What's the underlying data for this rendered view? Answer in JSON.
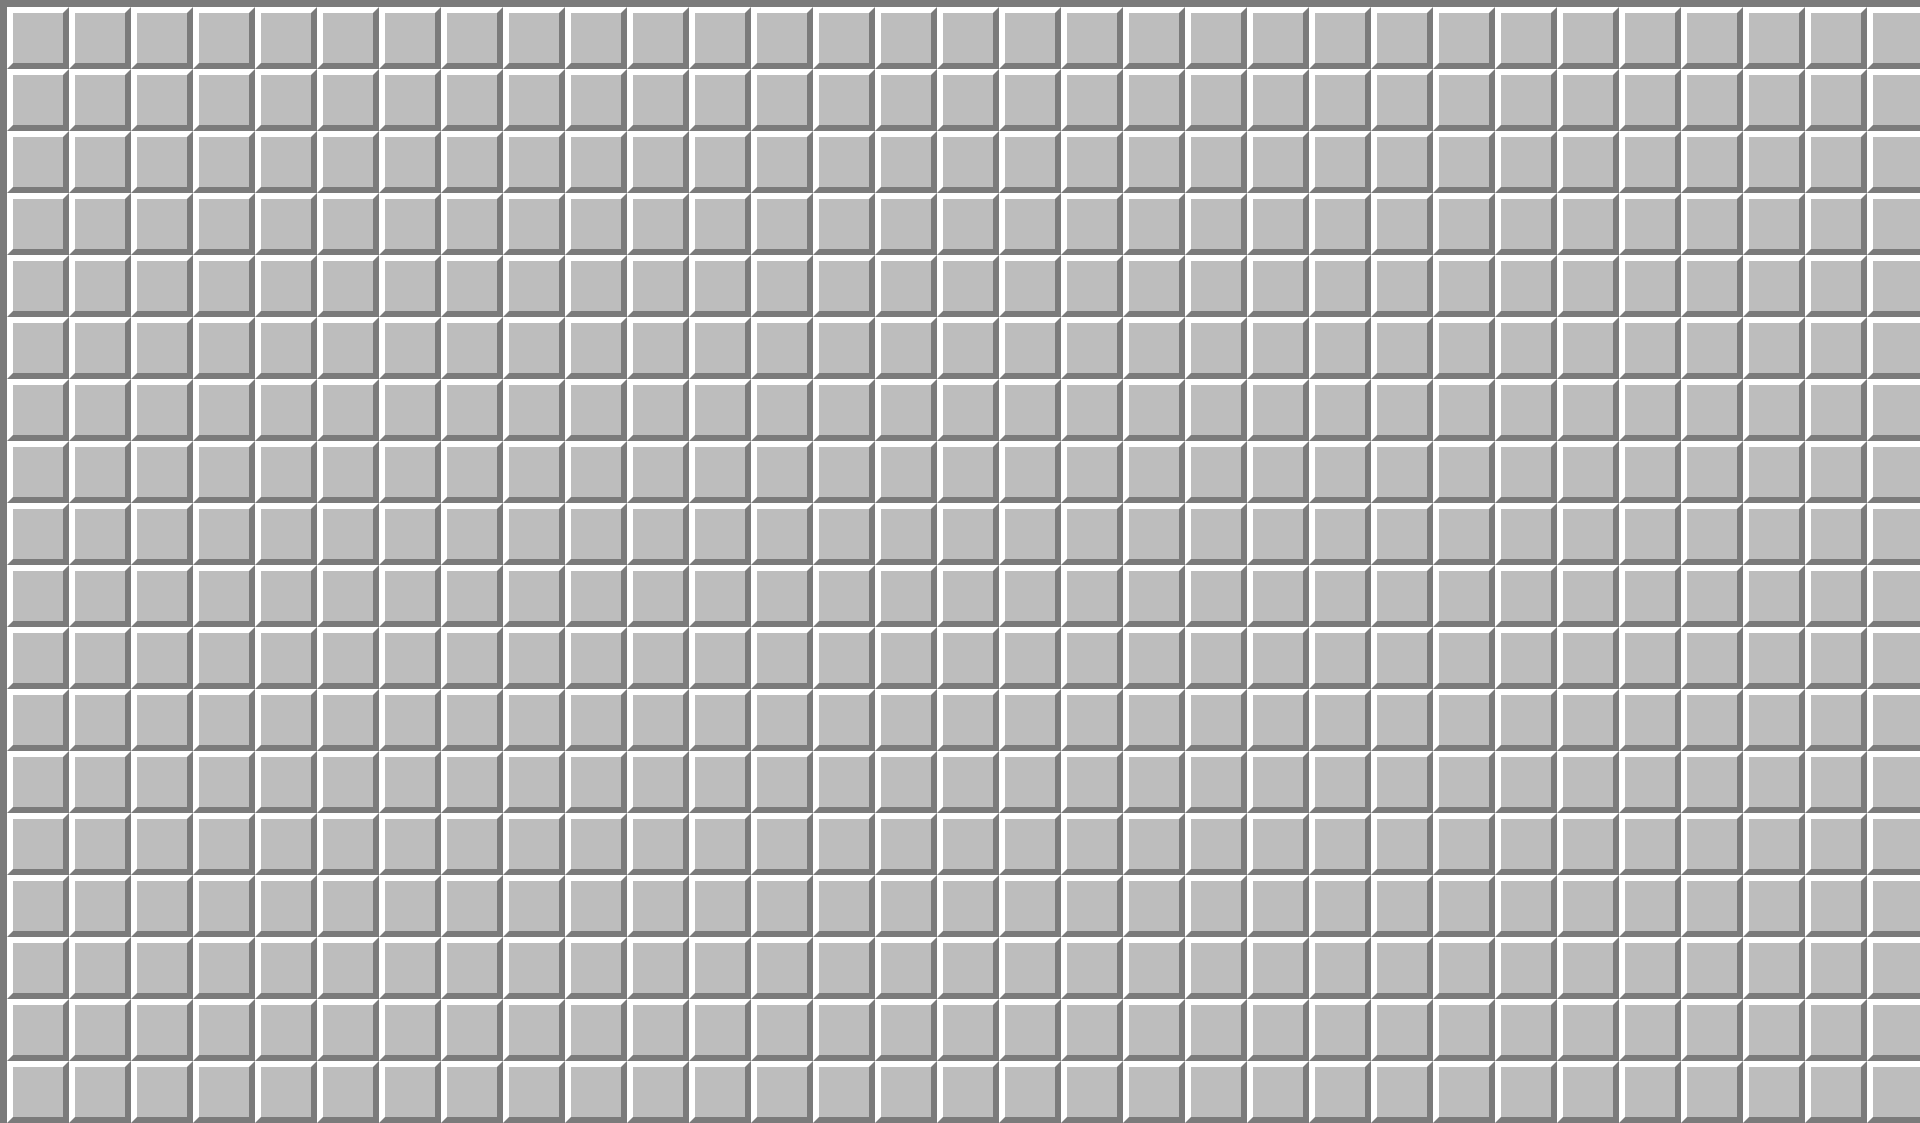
{
  "game": {
    "board": {
      "state": "all cells covered",
      "visible_rows": 17,
      "visible_cols": 31,
      "rendered_rows": 18,
      "rendered_cols": 32
    },
    "colors": {
      "cell_face": "#bdbdbd",
      "cell_highlight": "#ffffff",
      "cell_shadow": "#7b7b7b",
      "background": "#7b7b7b"
    }
  }
}
